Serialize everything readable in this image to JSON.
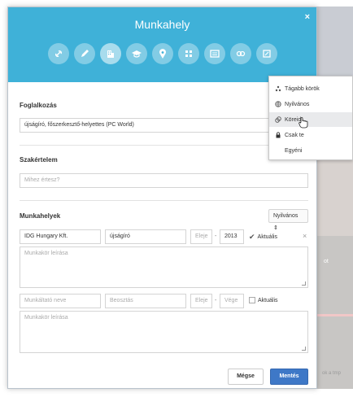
{
  "header": {
    "title": "Munkahely",
    "close": "×"
  },
  "header_icons": [
    "link-icon",
    "pencil-icon",
    "building-icon",
    "graduation-cap-icon",
    "map-pin-icon",
    "stats-icon",
    "list-icon",
    "link-chain-icon",
    "frame-icon"
  ],
  "occupation": {
    "label": "Foglalkozás",
    "value": "újságíró, főszerkesztő-helyettes (PC World)"
  },
  "expertise": {
    "label": "Szakértelem",
    "placeholder": "Mihez értesz?"
  },
  "workplaces": {
    "label": "Munkahelyek",
    "visibility": "Nyilvános ⇕",
    "entry1": {
      "company": "IDG Hungary Kft.",
      "position": "újságíró",
      "start_placeholder": "Eleje",
      "dash": "-",
      "end": "2013",
      "current_label": "Aktuális",
      "remove": "×",
      "description_placeholder": "Munkakör leírása"
    },
    "entry2": {
      "company_placeholder": "Munkáltató neve",
      "position_placeholder": "Beosztás",
      "start_placeholder": "Eleje",
      "dash": "-",
      "end_placeholder": "Vége",
      "current_label": "Aktuális",
      "description_placeholder": "Munkakör leírása"
    }
  },
  "buttons": {
    "cancel": "Mégse",
    "save": "Mentés"
  },
  "visibility_menu": {
    "items": [
      {
        "icon": "extended-circles-icon",
        "label": "Tágabb körök"
      },
      {
        "icon": "globe-icon",
        "label": "Nyilvános"
      },
      {
        "icon": "circles-icon",
        "label": "Köreid"
      },
      {
        "icon": "lock-icon",
        "label": "Csak te"
      },
      {
        "icon": "",
        "label": "Egyéni"
      }
    ],
    "highlighted_index": 2
  },
  "background": {
    "caption": "ot",
    "footer": "ok a tmp"
  },
  "colors": {
    "header": "#3fb1d8",
    "save_button": "#3e78c7",
    "menu_highlight": "#e9eaec"
  }
}
